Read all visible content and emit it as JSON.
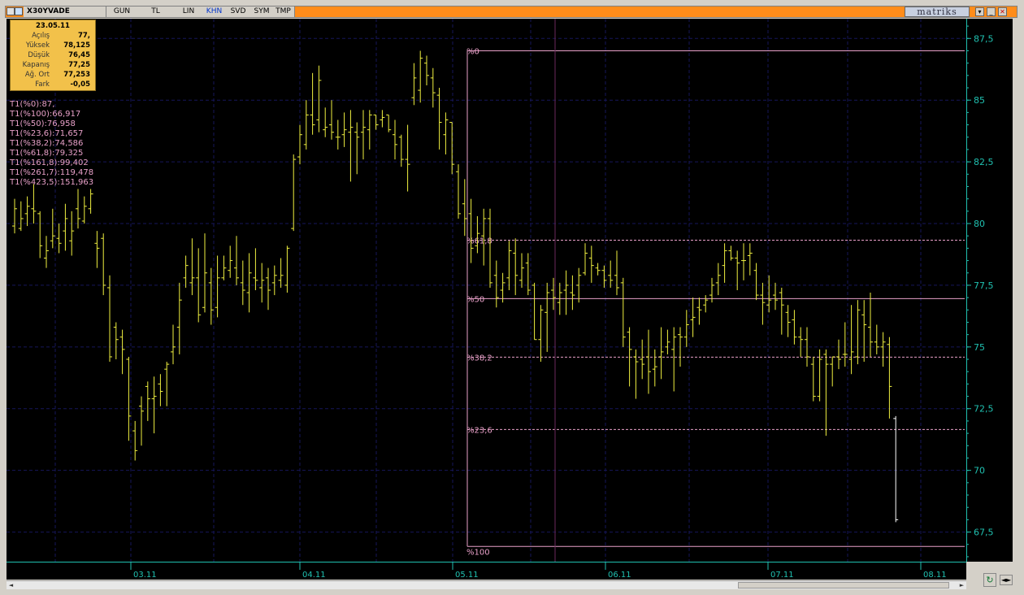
{
  "toolbar": {
    "symbol": "X30YVADE",
    "buttons": [
      {
        "label": "GUN",
        "active": false
      },
      {
        "label": "TL",
        "active": false
      },
      {
        "label": "LIN",
        "active": false
      },
      {
        "label": "KHN",
        "active": true
      },
      {
        "label": "SVD",
        "active": false
      },
      {
        "label": "SYM",
        "active": false
      },
      {
        "label": "TMP",
        "active": false
      }
    ],
    "brand": "matriks",
    "icons": [
      "window-icon",
      "chart-icon",
      "dropdown-icon",
      "minimize-icon",
      "close-icon"
    ],
    "accent_color": "#ff8c1a"
  },
  "info": {
    "date": "23.05.11",
    "rows": [
      {
        "label": "Açılış",
        "value": "77,"
      },
      {
        "label": "Yüksek",
        "value": "78,125"
      },
      {
        "label": "Düşük",
        "value": "76,45"
      },
      {
        "label": "Kapanış",
        "value": "77,25"
      },
      {
        "label": "Ağ. Ort",
        "value": "77,253"
      },
      {
        "label": "Fark",
        "value": "-0,05"
      }
    ]
  },
  "fib_list": [
    "T1(%0):87,",
    "T1(%100):66,917",
    "T1(%50):76,958",
    "T1(%23,6):71,657",
    "T1(%38,2):74,586",
    "T1(%61,8):79,325",
    "T1(%161,8):99,402",
    "T1(%261,7):119,478",
    "T1(%423,5):151,963"
  ],
  "chart_data": {
    "type": "bar",
    "ylim": [
      66.3,
      88.3
    ],
    "y_ticks": [
      {
        "value": 67.5,
        "label": "67,5"
      },
      {
        "value": 70,
        "label": "70"
      },
      {
        "value": 72.5,
        "label": "72,5"
      },
      {
        "value": 75,
        "label": "75"
      },
      {
        "value": 77.5,
        "label": "77,5"
      },
      {
        "value": 80,
        "label": "80"
      },
      {
        "value": 82.5,
        "label": "82,5"
      },
      {
        "value": 85,
        "label": "85"
      },
      {
        "value": 87.5,
        "label": "87,5"
      }
    ],
    "x_ticks": [
      "03.11",
      "04.11",
      "05.11",
      "06.11",
      "07.11",
      "08.11"
    ],
    "bars": [
      [
        79.9,
        81.0,
        79.6,
        80.6
      ],
      [
        79.8,
        80.9,
        79.7,
        80.2
      ],
      [
        80.4,
        81.1,
        79.9,
        80.7
      ],
      [
        80.6,
        81.6,
        80.0,
        80.5
      ],
      [
        80.4,
        80.5,
        78.6,
        79.1
      ],
      [
        78.6,
        79.5,
        78.2,
        78.9
      ],
      [
        79.3,
        80.6,
        79.0,
        79.5
      ],
      [
        79.4,
        80.0,
        78.8,
        79.2
      ],
      [
        79.7,
        80.8,
        78.9,
        80.2
      ],
      [
        79.3,
        80.5,
        78.7,
        79.7
      ],
      [
        80.6,
        81.4,
        79.8,
        80.2
      ],
      [
        80.1,
        81.1,
        80.0,
        80.7
      ],
      [
        80.6,
        81.4,
        80.4,
        81.2
      ],
      [
        79.2,
        79.7,
        78.2,
        79.0
      ],
      [
        79.4,
        79.6,
        77.1,
        77.5
      ],
      [
        77.4,
        77.9,
        74.4,
        74.6
      ],
      [
        75.8,
        76.0,
        74.5,
        75.3
      ],
      [
        75.4,
        75.7,
        73.9,
        74.9
      ],
      [
        74.5,
        74.6,
        71.2,
        72.2
      ],
      [
        71.6,
        72.0,
        70.4,
        70.8
      ],
      [
        72.6,
        73.0,
        71.0,
        72.4
      ],
      [
        73.4,
        73.6,
        72.0,
        72.9
      ],
      [
        72.9,
        73.8,
        71.5,
        73.0
      ],
      [
        73.5,
        73.9,
        72.6,
        73.2
      ],
      [
        74.1,
        74.4,
        72.6,
        74.3
      ],
      [
        74.8,
        75.9,
        74.3,
        75.0
      ],
      [
        75.8,
        77.6,
        74.7,
        76.9
      ],
      [
        77.8,
        78.7,
        77.4,
        78.3
      ],
      [
        77.6,
        79.4,
        77.1,
        77.8
      ],
      [
        77.8,
        79.0,
        76.0,
        76.3
      ],
      [
        76.6,
        79.6,
        76.4,
        78.0
      ],
      [
        77.6,
        78.2,
        75.9,
        76.5
      ],
      [
        76.6,
        78.7,
        76.2,
        77.8
      ],
      [
        77.8,
        78.7,
        77.7,
        78.2
      ],
      [
        78.1,
        79.1,
        77.8,
        78.5
      ],
      [
        78.2,
        79.5,
        77.5,
        77.8
      ],
      [
        77.6,
        78.5,
        76.7,
        77.3
      ],
      [
        77.2,
        78.8,
        76.4,
        78.0
      ],
      [
        77.8,
        79.0,
        77.3,
        77.7
      ],
      [
        77.4,
        78.4,
        76.8,
        77.7
      ],
      [
        77.8,
        78.2,
        76.5,
        77.3
      ],
      [
        77.6,
        78.3,
        77.1,
        77.9
      ],
      [
        77.7,
        78.6,
        77.4,
        77.9
      ],
      [
        77.5,
        79.1,
        77.2,
        79.0
      ],
      [
        79.8,
        82.8,
        79.7,
        82.6
      ],
      [
        82.7,
        84.0,
        82.4,
        83.6
      ],
      [
        83.2,
        85.0,
        83.0,
        84.4
      ],
      [
        84.4,
        86.1,
        83.6,
        84.0
      ],
      [
        84.2,
        86.4,
        83.7,
        85.8
      ],
      [
        83.8,
        84.7,
        83.5,
        83.9
      ],
      [
        84.0,
        85.0,
        83.4,
        83.7
      ],
      [
        83.5,
        84.2,
        83.0,
        83.5
      ],
      [
        83.6,
        84.5,
        83.1,
        83.8
      ],
      [
        83.7,
        84.6,
        81.7,
        83.9
      ],
      [
        83.7,
        84.1,
        82.0,
        83.5
      ],
      [
        83.7,
        84.6,
        82.6,
        83.9
      ],
      [
        83.8,
        84.6,
        83.0,
        84.4
      ],
      [
        84.4,
        84.4,
        83.8,
        84.0
      ],
      [
        84.2,
        84.6,
        83.9,
        84.3
      ],
      [
        84.4,
        84.4,
        83.7,
        83.8
      ],
      [
        83.6,
        84.2,
        82.6,
        83.2
      ],
      [
        83.5,
        83.6,
        82.3,
        82.6
      ],
      [
        82.6,
        84.0,
        81.3,
        82.4
      ],
      [
        85.1,
        86.5,
        84.8,
        85.9
      ],
      [
        85.4,
        87.0,
        84.9,
        86.7
      ],
      [
        86.5,
        86.8,
        85.6,
        86.0
      ],
      [
        85.9,
        86.3,
        84.7,
        85.3
      ],
      [
        85.2,
        85.5,
        83.0,
        84.1
      ],
      [
        83.6,
        84.5,
        82.8,
        84.2
      ],
      [
        84.1,
        84.1,
        82.0,
        82.4
      ],
      [
        82.1,
        82.4,
        80.2,
        80.4
      ],
      [
        80.8,
        81.8,
        79.5,
        80.2
      ],
      [
        80.4,
        81.0,
        78.4,
        79.0
      ],
      [
        79.1,
        80.3,
        78.8,
        79.6
      ],
      [
        79.5,
        80.6,
        78.3,
        80.2
      ],
      [
        80.2,
        80.6,
        77.4,
        77.6
      ],
      [
        77.9,
        78.5,
        76.6,
        77.0
      ],
      [
        77.3,
        78.0,
        76.8,
        77.6
      ],
      [
        77.8,
        79.3,
        77.3,
        78.9
      ],
      [
        78.8,
        79.4,
        77.1,
        77.9
      ],
      [
        77.7,
        78.8,
        77.4,
        78.2
      ],
      [
        78.4,
        78.8,
        77.1,
        77.3
      ],
      [
        77.5,
        77.6,
        75.3,
        75.3
      ],
      [
        75.3,
        76.7,
        74.4,
        76.5
      ],
      [
        76.4,
        77.6,
        74.8,
        77.2
      ],
      [
        77.3,
        77.8,
        76.5,
        77.0
      ],
      [
        76.8,
        77.6,
        76.3,
        77.2
      ],
      [
        77.3,
        78.1,
        76.3,
        77.5
      ],
      [
        77.2,
        77.9,
        76.5,
        77.1
      ],
      [
        77.5,
        78.2,
        76.8,
        77.9
      ],
      [
        78.0,
        79.2,
        77.9,
        78.8
      ],
      [
        78.6,
        79.1,
        77.6,
        78.3
      ],
      [
        78.2,
        78.4,
        77.9,
        78.1
      ],
      [
        78.1,
        78.3,
        77.4,
        77.7
      ],
      [
        77.9,
        78.5,
        77.4,
        77.7
      ],
      [
        77.9,
        78.9,
        77.1,
        77.4
      ],
      [
        77.6,
        77.8,
        75.0,
        75.4
      ],
      [
        75.6,
        75.8,
        73.4,
        74.9
      ],
      [
        74.6,
        74.9,
        72.9,
        74.4
      ],
      [
        74.5,
        75.3,
        73.7,
        74.3
      ],
      [
        74.6,
        75.7,
        73.1,
        74.0
      ],
      [
        74.1,
        74.9,
        73.4,
        74.2
      ],
      [
        74.6,
        75.8,
        73.7,
        74.8
      ],
      [
        75.0,
        75.7,
        74.7,
        75.2
      ],
      [
        74.9,
        75.8,
        73.2,
        75.4
      ],
      [
        75.5,
        75.8,
        74.2,
        75.4
      ],
      [
        75.4,
        76.5,
        75.0,
        75.9
      ],
      [
        76.1,
        77.0,
        75.4,
        76.2
      ],
      [
        76.6,
        77.0,
        75.9,
        76.5
      ],
      [
        76.7,
        77.1,
        76.4,
        76.9
      ],
      [
        77.1,
        77.8,
        76.8,
        77.5
      ],
      [
        77.6,
        78.4,
        77.1,
        77.9
      ],
      [
        78.3,
        79.2,
        77.6,
        78.9
      ],
      [
        78.9,
        79.1,
        78.5,
        78.6
      ],
      [
        78.6,
        78.9,
        77.3,
        78.4
      ],
      [
        78.5,
        79.2,
        77.7,
        78.5
      ],
      [
        78.7,
        79.2,
        77.9,
        78.8
      ],
      [
        78.1,
        78.4,
        76.9,
        77.1
      ],
      [
        77.1,
        77.6,
        75.9,
        76.8
      ],
      [
        76.7,
        77.9,
        76.4,
        76.9
      ],
      [
        77.1,
        77.6,
        76.5,
        76.9
      ],
      [
        77.2,
        77.4,
        75.5,
        76.7
      ],
      [
        76.4,
        76.7,
        75.4,
        76.0
      ],
      [
        76.1,
        76.5,
        75.1,
        75.4
      ],
      [
        75.4,
        75.8,
        74.6,
        75.3
      ],
      [
        75.3,
        75.8,
        74.2,
        74.6
      ],
      [
        74.3,
        74.6,
        72.8,
        73.0
      ],
      [
        73.0,
        74.9,
        72.8,
        74.5
      ],
      [
        74.7,
        74.9,
        71.4,
        74.3
      ],
      [
        74.3,
        74.6,
        73.4,
        74.6
      ],
      [
        74.6,
        75.3,
        74.1,
        74.5
      ],
      [
        74.7,
        76.0,
        74.2,
        74.7
      ],
      [
        74.5,
        76.7,
        73.9,
        74.8
      ],
      [
        74.6,
        76.9,
        74.3,
        76.5
      ],
      [
        76.3,
        76.9,
        74.4,
        75.9
      ],
      [
        75.8,
        77.2,
        74.6,
        75.2
      ],
      [
        75.2,
        75.9,
        74.7,
        75.0
      ],
      [
        75.0,
        75.6,
        74.2,
        75.2
      ],
      [
        75.1,
        75.4,
        72.1,
        73.4
      ],
      [
        72.1,
        72.2,
        67.9,
        68.0
      ]
    ],
    "fib_levels": [
      {
        "label": "%0",
        "value": 87.0,
        "style": "solid"
      },
      {
        "label": "%61,8",
        "value": 79.325,
        "style": "dashed"
      },
      {
        "label": "%50",
        "value": 76.958,
        "style": "solid"
      },
      {
        "label": "%38,2",
        "value": 74.586,
        "style": "dashed"
      },
      {
        "label": "%23,6",
        "value": 71.657,
        "style": "dashed"
      },
      {
        "label": "%100",
        "value": 66.917,
        "style": "solid"
      }
    ],
    "colors": {
      "bars": "#f0f040",
      "last_bar": "#ffffff",
      "fib": "#e8a0c8",
      "axis_text": "#20c0b0",
      "grid": "#16165a",
      "background": "#000000"
    }
  }
}
